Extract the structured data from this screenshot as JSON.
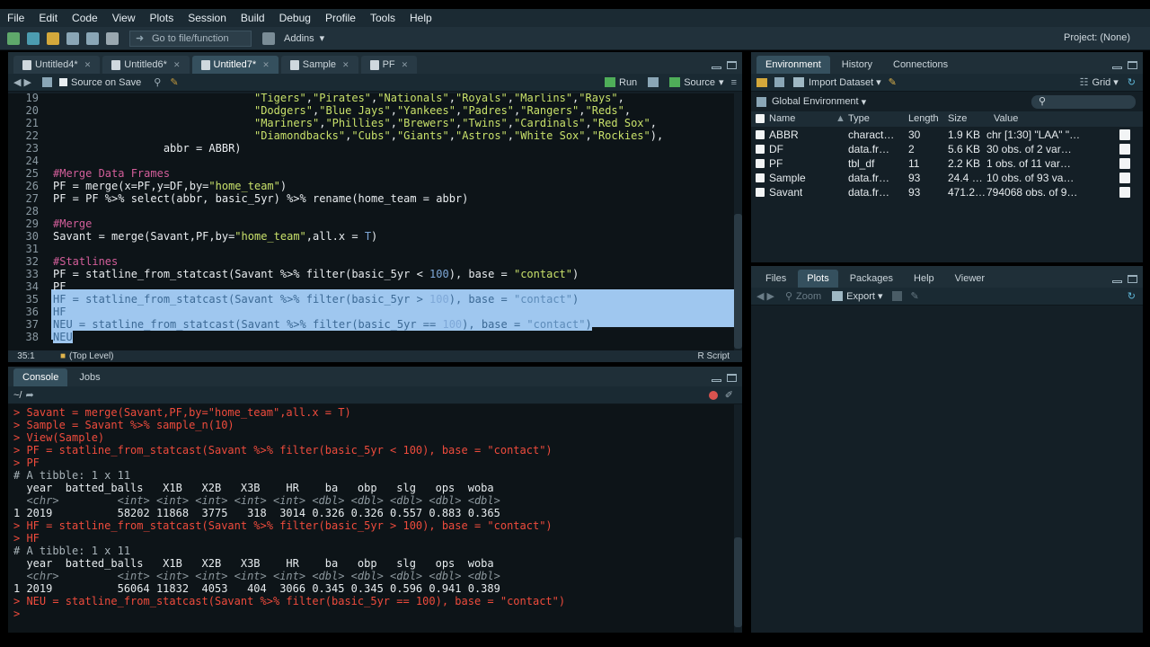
{
  "menu": [
    "File",
    "Edit",
    "Code",
    "View",
    "Plots",
    "Session",
    "Build",
    "Debug",
    "Profile",
    "Tools",
    "Help"
  ],
  "toolbar": {
    "goto": "Go to file/function",
    "addins": "Addins",
    "project": "Project: (None)"
  },
  "editor": {
    "tabs": [
      "Untitled4*",
      "Untitled6*",
      "Untitled7*",
      "Sample",
      "PF"
    ],
    "source_on_save": "Source on Save",
    "run": "Run",
    "source": "Source",
    "cursor_pos": "35:1",
    "scope": "(Top Level)",
    "filetype": "R Script",
    "lines": [
      {
        "n": "19",
        "t": "                               \"Tigers\",\"Pirates\",\"Nationals\",\"Royals\",\"Marlins\",\"Rays\","
      },
      {
        "n": "20",
        "t": "                               \"Dodgers\",\"Blue Jays\",\"Yankees\",\"Padres\",\"Rangers\",\"Reds\","
      },
      {
        "n": "21",
        "t": "                               \"Mariners\",\"Phillies\",\"Brewers\",\"Twins\",\"Cardinals\",\"Red Sox\","
      },
      {
        "n": "22",
        "t": "                               \"Diamondbacks\",\"Cubs\",\"Giants\",\"Astros\",\"White Sox\",\"Rockies\"),"
      },
      {
        "n": "23",
        "t": "                 abbr = ABBR)"
      },
      {
        "n": "24",
        "t": ""
      },
      {
        "n": "25",
        "t": "#Merge Data Frames"
      },
      {
        "n": "26",
        "t": "PF = merge(x=PF,y=DF,by=\"home_team\")"
      },
      {
        "n": "27",
        "t": "PF = PF %>% select(abbr, basic_5yr) %>% rename(home_team = abbr)"
      },
      {
        "n": "28",
        "t": ""
      },
      {
        "n": "29",
        "t": "#Merge"
      },
      {
        "n": "30",
        "t": "Savant = merge(Savant,PF,by=\"home_team\",all.x = T)"
      },
      {
        "n": "31",
        "t": ""
      },
      {
        "n": "32",
        "t": "#Statlines"
      },
      {
        "n": "33",
        "t": "PF = statline_from_statcast(Savant %>% filter(basic_5yr < 100), base = \"contact\")"
      },
      {
        "n": "34",
        "t": "PF"
      },
      {
        "n": "35",
        "t": "HF = statline_from_statcast(Savant %>% filter(basic_5yr > 100), base = \"contact\")"
      },
      {
        "n": "36",
        "t": "HF"
      },
      {
        "n": "37",
        "t": "NEU = statline_from_statcast(Savant %>% filter(basic_5yr == 100), base = \"contact\")"
      },
      {
        "n": "38",
        "t": "NEU"
      }
    ]
  },
  "console": {
    "tabs": [
      "Console",
      "Jobs"
    ],
    "path": "~/",
    "lines": [
      {
        "k": "cmd",
        "t": "> Savant = merge(Savant,PF,by=\"home_team\",all.x = T)"
      },
      {
        "k": "cmd",
        "t": "> Sample = Savant %>% sample_n(10)"
      },
      {
        "k": "cmd",
        "t": "> View(Sample)"
      },
      {
        "k": "cmd",
        "t": "> PF = statline_from_statcast(Savant %>% filter(basic_5yr < 100), base = \"contact\")"
      },
      {
        "k": "cmd",
        "t": "> PF"
      },
      {
        "k": "cmt",
        "t": "# A tibble: 1 x 11"
      },
      {
        "k": "out",
        "t": "  year  batted_balls   X1B   X2B   X3B    HR    ba   obp   slg   ops  woba"
      },
      {
        "k": "type",
        "t": "  <chr>         <int> <int> <int> <int> <int> <dbl> <dbl> <dbl> <dbl> <dbl>"
      },
      {
        "k": "out",
        "t": "1 2019          58202 11868  3775   318  3014 0.326 0.326 0.557 0.883 0.365"
      },
      {
        "k": "cmd",
        "t": "> HF = statline_from_statcast(Savant %>% filter(basic_5yr > 100), base = \"contact\")"
      },
      {
        "k": "cmd",
        "t": "> HF"
      },
      {
        "k": "cmt",
        "t": "# A tibble: 1 x 11"
      },
      {
        "k": "out",
        "t": "  year  batted_balls   X1B   X2B   X3B    HR    ba   obp   slg   ops  woba"
      },
      {
        "k": "type",
        "t": "  <chr>         <int> <int> <int> <int> <int> <dbl> <dbl> <dbl> <dbl> <dbl>"
      },
      {
        "k": "out",
        "t": "1 2019          56064 11832  4053   404  3066 0.345 0.345 0.596 0.941 0.389"
      },
      {
        "k": "cmd",
        "t": "> NEU = statline_from_statcast(Savant %>% filter(basic_5yr == 100), base = \"contact\")"
      },
      {
        "k": "cmd",
        "t": ">"
      }
    ]
  },
  "env": {
    "tabs": [
      "Environment",
      "History",
      "Connections"
    ],
    "import": "Import Dataset",
    "view": "Grid",
    "scope": "Global Environment",
    "columns": [
      "Name",
      "Type",
      "Length",
      "Size",
      "Value"
    ],
    "rows": [
      {
        "name": "ABBR",
        "type": "charact…",
        "length": "30",
        "size": "1.9 KB",
        "value": "chr [1:30] \"LAA\" \"…"
      },
      {
        "name": "DF",
        "type": "data.fr…",
        "length": "2",
        "size": "5.6 KB",
        "value": "30 obs. of 2 var…"
      },
      {
        "name": "PF",
        "type": "tbl_df",
        "length": "11",
        "size": "2.2 KB",
        "value": "1 obs. of 11 var…"
      },
      {
        "name": "Sample",
        "type": "data.fr…",
        "length": "93",
        "size": "24.4 …",
        "value": "10 obs. of 93 va…"
      },
      {
        "name": "Savant",
        "type": "data.fr…",
        "length": "93",
        "size": "471.2…",
        "value": "794068 obs. of 9…"
      }
    ]
  },
  "files": {
    "tabs": [
      "Files",
      "Plots",
      "Packages",
      "Help",
      "Viewer"
    ],
    "zoom": "Zoom",
    "export": "Export"
  }
}
